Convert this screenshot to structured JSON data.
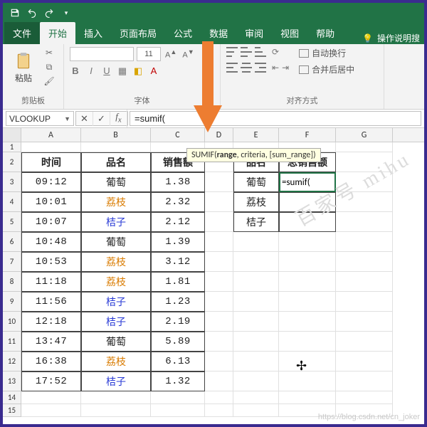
{
  "qat": {
    "save": "save",
    "undo": "undo",
    "redo": "redo"
  },
  "tabs": {
    "file": "文件",
    "home": "开始",
    "insert": "插入",
    "layout": "页面布局",
    "formulas": "公式",
    "data": "数据",
    "review": "审阅",
    "view": "视图",
    "help": "帮助",
    "tellme": "操作说明搜"
  },
  "ribbon": {
    "clipboard_label": "剪贴板",
    "paste_label": "粘贴",
    "font_label": "字体",
    "font_size": "11",
    "align_label": "对齐方式",
    "wrap_text": "自动换行",
    "merge_center": "合并后居中"
  },
  "namebox": "VLOOKUP",
  "formula": "=sumif(",
  "tooltip": {
    "func": "SUMIF(",
    "arg1": "range",
    "rest": ", criteria, [sum_range])"
  },
  "columns": [
    "A",
    "B",
    "C",
    "D",
    "E",
    "F",
    "G"
  ],
  "rownums": [
    "1",
    "2",
    "3",
    "4",
    "5",
    "6",
    "7",
    "8",
    "9",
    "10",
    "11",
    "12",
    "13",
    "14",
    "15"
  ],
  "table1": {
    "headers": {
      "time": "时间",
      "name": "品名",
      "sales": "销售额"
    },
    "rows": [
      {
        "time": "09:12",
        "name": "葡萄",
        "sales": "1.38",
        "cls": ""
      },
      {
        "time": "10:01",
        "name": "荔枝",
        "sales": "2.32",
        "cls": "orange"
      },
      {
        "time": "10:07",
        "name": "桔子",
        "sales": "2.12",
        "cls": "blue"
      },
      {
        "time": "10:48",
        "name": "葡萄",
        "sales": "1.39",
        "cls": ""
      },
      {
        "time": "10:53",
        "name": "荔枝",
        "sales": "3.12",
        "cls": "orange"
      },
      {
        "time": "11:18",
        "name": "荔枝",
        "sales": "1.81",
        "cls": "orange"
      },
      {
        "time": "11:56",
        "name": "桔子",
        "sales": "1.23",
        "cls": "blue"
      },
      {
        "time": "12:18",
        "name": "桔子",
        "sales": "2.19",
        "cls": "blue"
      },
      {
        "time": "13:47",
        "name": "葡萄",
        "sales": "5.89",
        "cls": ""
      },
      {
        "time": "16:38",
        "name": "荔枝",
        "sales": "6.13",
        "cls": "orange"
      },
      {
        "time": "17:52",
        "name": "桔子",
        "sales": "1.32",
        "cls": "blue"
      }
    ]
  },
  "table2": {
    "headers": {
      "name": "品名",
      "total": "总销售额"
    },
    "rows": [
      {
        "name": "葡萄",
        "total": "=sumif("
      },
      {
        "name": "荔枝",
        "total": ""
      },
      {
        "name": "桔子",
        "total": ""
      }
    ]
  },
  "watermark_side": "百家号 mihu",
  "watermark_url": "https://blog.csdn.net/cn_joker"
}
